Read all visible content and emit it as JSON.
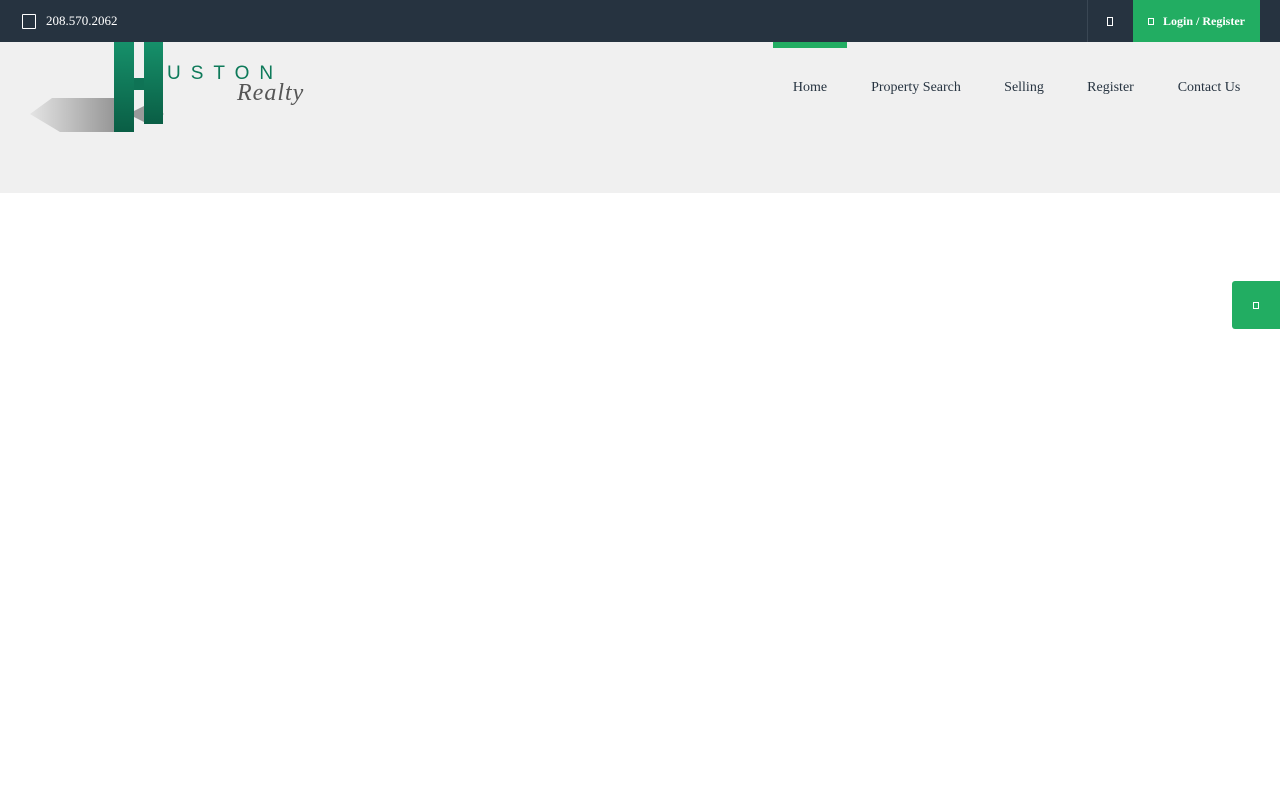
{
  "topbar": {
    "phone": "208.570.2062",
    "phone_icon": "phone-icon",
    "search_icon": "search-icon",
    "login_icon": "user-icon",
    "login_label": "Login / Register"
  },
  "logo": {
    "letter": "H",
    "text": "USTON",
    "script": "Realty"
  },
  "nav": {
    "items": [
      {
        "label": "Home",
        "active": true
      },
      {
        "label": "Property Search",
        "active": false
      },
      {
        "label": "Selling",
        "active": false
      },
      {
        "label": "Register",
        "active": false
      },
      {
        "label": "Contact Us",
        "active": false
      }
    ]
  },
  "side_button": {
    "icon": "settings-icon"
  },
  "colors": {
    "topbar_bg": "#263340",
    "accent": "#22ad62",
    "header_bg": "#f0f0f0",
    "logo_green": "#0e7a5a"
  }
}
